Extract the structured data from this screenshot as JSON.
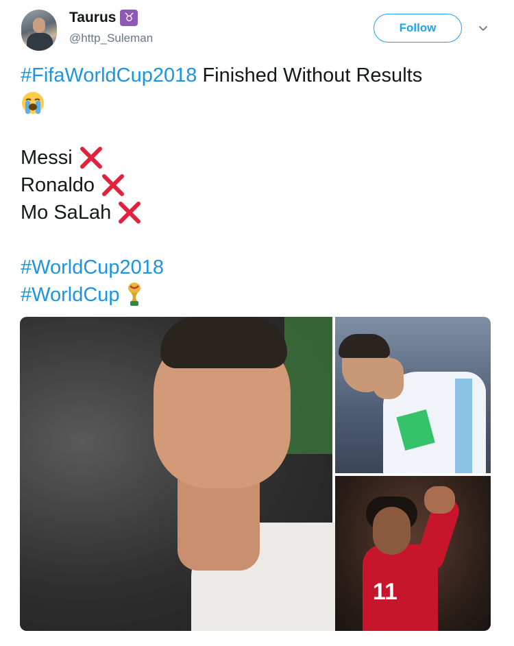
{
  "user": {
    "display_name": "Taurus",
    "zodiac_symbol": "♉",
    "handle": "@http_Suleman"
  },
  "follow_label": "Follow",
  "icons": {
    "caret": "chevron-down-icon",
    "cross": "cross-mark-icon",
    "crying": "loudly-crying-face-icon",
    "trophy": "world-cup-trophy-icon"
  },
  "tweet": {
    "hashtag1": "#FifaWorldCup2018",
    "text1": " Finished Without Results",
    "players": [
      "Messi",
      "Ronaldo",
      "Mo SaLah"
    ],
    "hashtag2": "#WorldCup2018",
    "hashtag3": "#WorldCup"
  },
  "media": {
    "shirt_number": "11"
  },
  "colors": {
    "link": "#1b95e0",
    "accent": "#1da1f2",
    "cross": "#e0223c",
    "zodiac_bg": "#8e59b4"
  }
}
